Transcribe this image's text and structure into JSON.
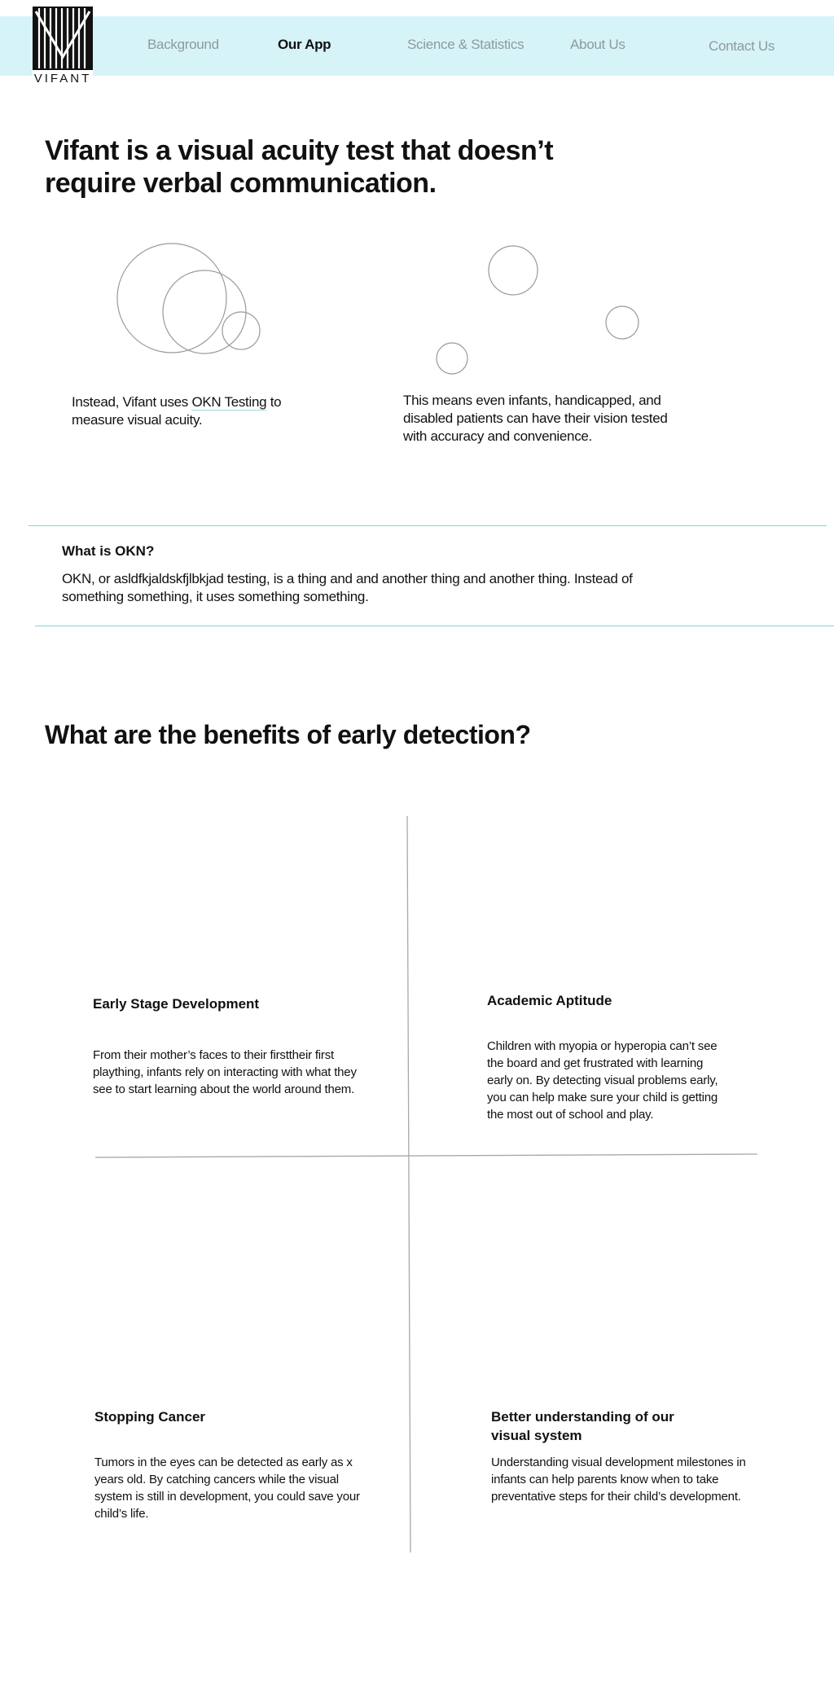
{
  "brand": {
    "name": "VIFANT"
  },
  "nav": {
    "items": [
      {
        "label": "Background",
        "active": false
      },
      {
        "label": "Our App",
        "active": true
      },
      {
        "label": "Science & Statistics",
        "active": false
      },
      {
        "label": "About Us",
        "active": false
      },
      {
        "label": "Contact Us",
        "active": false
      }
    ]
  },
  "hero": {
    "title": "Vifant is a visual acuity test that doesn’t require verbal communication.",
    "left_text_before": "Instead, Vifant uses ",
    "left_link": "OKN Testing",
    "left_text_after": " to measure visual acuity.",
    "right_text": "This means even infants, handicapped, and disabled patients can have their vision tested with accuracy and convenience."
  },
  "okn": {
    "title": "What is OKN?",
    "text": "OKN, or asldfkjaldskfjlbkjad testing, is a thing and and another thing and another thing. Instead of something something, it uses something something."
  },
  "benefits": {
    "title": "What are the benefits of early detection?",
    "items": [
      {
        "title": "Early Stage Development",
        "text": "From their mother’s faces to their firsttheir first plaything, infants rely on interacting with what they see to start learning about the world around them."
      },
      {
        "title": "Academic Aptitude",
        "text": "Children with myopia or hyperopia can’t see the board and get frustrated with learning early on. By detecting visual problems early, you can help make sure your child is getting the most out of school and play."
      },
      {
        "title": "Stopping Cancer",
        "text": "Tumors in the eyes can be detected as early as x years old. By catching cancers while the visual system is still in development, you could save your child’s life."
      },
      {
        "title": "Better understanding of our visual system",
        "text": "Understanding visual development milestones in infants can help parents know when to take preventative steps for their child’s development."
      }
    ]
  },
  "colors": {
    "nav_bg": "#d6f3f8",
    "accent_line": "#7ad9d9",
    "nav_inactive": "#8f9a9d"
  }
}
